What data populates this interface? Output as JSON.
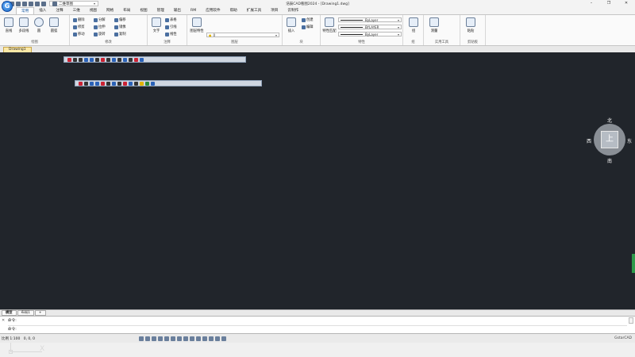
{
  "window": {
    "title": "浩辰CAD看图2024 - [Drawing1.dwg]",
    "workspace": "二维草图",
    "login": "登录"
  },
  "menu_tabs": [
    "常用",
    "插入",
    "注释",
    "三维",
    "视图",
    "网格",
    "布局",
    "视图",
    "管理",
    "输出",
    "RM",
    "应用软件",
    "帮助",
    "扩展工具",
    "项目",
    "云制作"
  ],
  "active_tab_index": 0,
  "ribbon": {
    "draw": {
      "label": "绘图",
      "line": "直线",
      "polyline": "多段线",
      "circle": "圆",
      "arc": "圆弧"
    },
    "modify": {
      "label": "修改",
      "delete": "删除",
      "explode": "分解",
      "trim": "修剪",
      "copy": "复制",
      "move": "移动",
      "rotate": "旋转",
      "stretch": "拉伸",
      "mirror": "镜像",
      "offset": "偏移"
    },
    "annotation": {
      "label": "注释",
      "text": "文字",
      "table": "表格",
      "leader": "引线",
      "linear": "线性"
    },
    "layers": {
      "label": "图层",
      "props": "图层特性",
      "current": "0"
    },
    "block": {
      "label": "块",
      "insert": "插入",
      "create": "创建",
      "edit": "编辑"
    },
    "properties": {
      "label": "特性",
      "match": "特性匹配",
      "bylayer1": "ByLayer",
      "bylayer2": "BYLAYER",
      "bylayer3": "ByLayer"
    },
    "group": {
      "label": "组",
      "btn": "组"
    },
    "utilities": {
      "label": "实用工具",
      "measure": "测量"
    },
    "clipboard": {
      "label": "剪贴板",
      "paste": "粘贴"
    }
  },
  "document_tab": "Drawing1",
  "viewcube": {
    "face": "上",
    "north": "北",
    "south": "南",
    "east": "东",
    "west": "西"
  },
  "ucs": {
    "x": "X",
    "y": "Y"
  },
  "layout_tabs": [
    "模型",
    "布局1",
    "+"
  ],
  "command_lines": [
    "命令:",
    "命令:"
  ],
  "status": {
    "scale": "比例 1:100",
    "coords": "0, 0, 0",
    "app": "GstarCAD"
  },
  "colors": {
    "canvas": "#21252b",
    "accent": "#1a5aa0",
    "doc_tab": "#fbe8a6",
    "nav_handle": "#2e9a4a"
  }
}
